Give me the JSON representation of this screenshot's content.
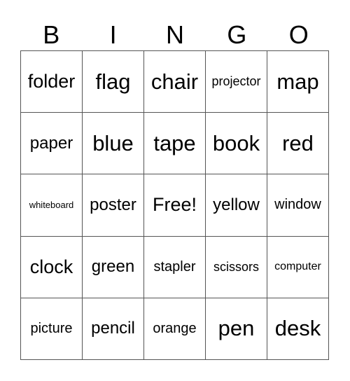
{
  "header": [
    "B",
    "I",
    "N",
    "G",
    "O"
  ],
  "cells": [
    [
      "folder",
      "flag",
      "chair",
      "projector",
      "map"
    ],
    [
      "paper",
      "blue",
      "tape",
      "book",
      "red"
    ],
    [
      "whiteboard",
      "poster",
      "Free!",
      "yellow",
      "window"
    ],
    [
      "clock",
      "green",
      "stapler",
      "scissors",
      "computer"
    ],
    [
      "picture",
      "pencil",
      "orange",
      "pen",
      "desk"
    ]
  ]
}
